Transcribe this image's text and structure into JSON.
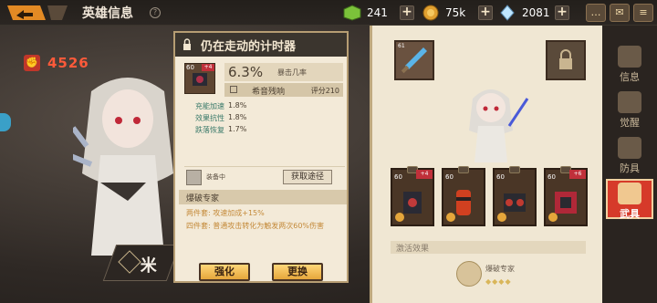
{
  "header": {
    "title": "英雄信息",
    "help_icon": "question-icon",
    "resources": [
      {
        "name": "green-cube",
        "value": "241",
        "color": "#7bc23a"
      },
      {
        "name": "gold-coin",
        "value": "75k",
        "color": "#e0a030"
      },
      {
        "name": "crystal",
        "value": "2081",
        "color": "#bfe6ff"
      }
    ],
    "top_icons": [
      "chat-icon",
      "mail-icon",
      "menu-icon"
    ]
  },
  "hero": {
    "power": "4526",
    "name_initial": "米"
  },
  "popup": {
    "title": "仍在走动的计时器",
    "item": {
      "level": "60",
      "plus": "+4"
    },
    "main_stat": {
      "value": "6.3%",
      "name": "暴击几率"
    },
    "sub": {
      "label": "希音残响",
      "score": "评分210"
    },
    "attributes": [
      {
        "name": "充能加速",
        "value": "1.8%"
      },
      {
        "name": "效果抗性",
        "value": "1.8%"
      },
      {
        "name": "跌落恢复",
        "value": "1.7%"
      }
    ],
    "equipped_label": "装备中",
    "get_path_button": "获取途径",
    "set_name": "爆破专家",
    "set_two": "两件套: 攻速加成+15%",
    "set_four": "四件套: 普通攻击转化为触发两次60%伤害",
    "enhance_button": "强化",
    "replace_button": "更换"
  },
  "equipment": {
    "weapon": {
      "level": "61"
    },
    "artifacts": [
      {
        "level": "60",
        "tag": "+4",
        "color": "#c03a3a"
      },
      {
        "level": "60",
        "tag": "",
        "color": "#d04020"
      },
      {
        "level": "60",
        "tag": "",
        "color": "#c03a30"
      },
      {
        "level": "60",
        "tag": "+6",
        "color": "#b02838"
      }
    ],
    "activate_label": "激活效果",
    "set_name": "爆破专家",
    "set_dots": "◆◆◆◆"
  },
  "tabs": [
    {
      "label": "信息",
      "icon": "info-icon",
      "active": false
    },
    {
      "label": "觉醒",
      "icon": "awaken-icon",
      "active": false
    },
    {
      "label": "防具",
      "icon": "armor-icon",
      "active": false
    },
    {
      "label": "武具",
      "icon": "weapon-icon",
      "active": true
    }
  ]
}
